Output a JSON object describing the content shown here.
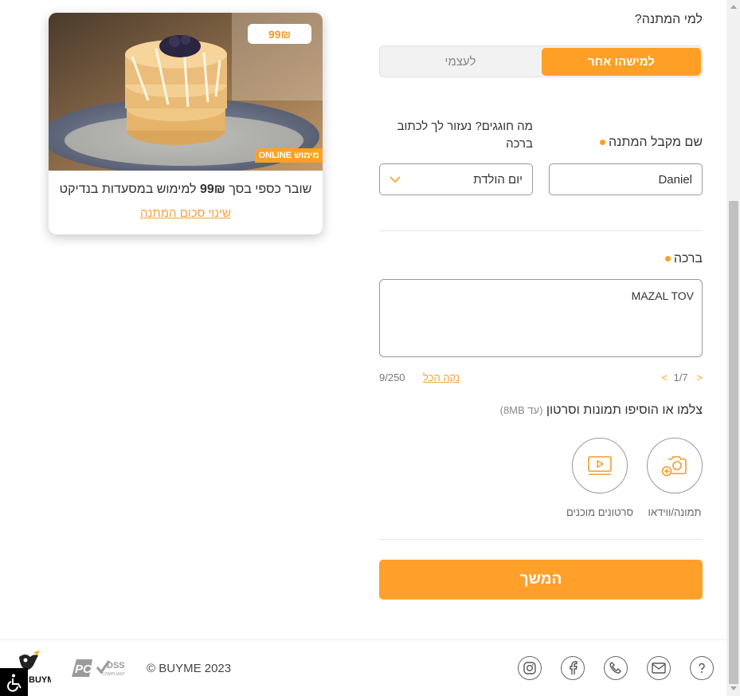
{
  "form": {
    "question": "למי המתנה?",
    "toggle": {
      "active": "למישהו אחר",
      "inactive": "לעצמי"
    },
    "recipient_label": "שם מקבל המתנה",
    "recipient_value": "Daniel",
    "occasion_label": "מה חוגגים? נעזור לך לכתוב ברכה",
    "occasion_value": "יום הולדת",
    "blessing_label": "ברכה",
    "blessing_value": "MAZAL TOV",
    "pager": {
      "text": "1/7"
    },
    "clear_all": "נקה הכל",
    "char_count": "9/250",
    "media_label": "צלמו או הוסיפו תמונות וסרטון",
    "media_limit": "(עד 8MB)",
    "photo_label": "תמונה/ווידאו",
    "video_label": "סרטונים מוכנים",
    "continue": "המשך"
  },
  "gift": {
    "price": "99₪",
    "online": "ONLINE",
    "online_prefix": "מימוש",
    "desc_pre": "שובר כספי בסך",
    "desc_amount": "99₪",
    "desc_post": "למימוש במסעדות בנדיקט",
    "change_amount": "שינוי סכום המתנה"
  },
  "footer": {
    "copyright": "BUYME 2023",
    "copyright_symbol": "©",
    "pci_text": "PCI",
    "dss_text": "DSS",
    "compliant_text": "COMPLIANT",
    "logo_text": "BUYME",
    "social_icons": [
      "help-icon",
      "mail-icon",
      "phone-icon",
      "facebook-icon",
      "instagram-icon"
    ]
  },
  "colors": {
    "accent": "#ffa026",
    "link": "#f4a040"
  }
}
